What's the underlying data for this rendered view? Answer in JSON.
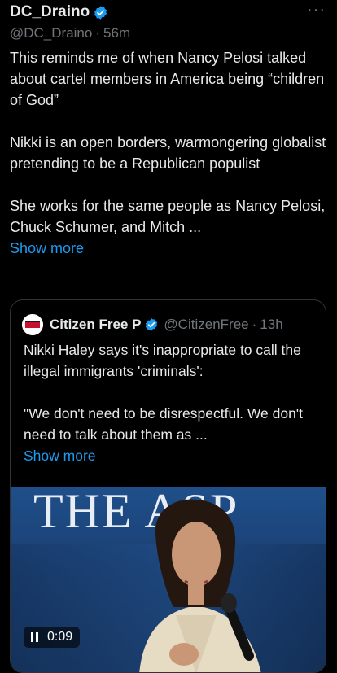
{
  "author": {
    "name": "DC_Draino",
    "handle": "@DC_Draino",
    "separator": "·",
    "time": "56m"
  },
  "more_label": "···",
  "post": {
    "paragraph1": "This reminds me of when Nancy Pelosi talked about cartel members in America being “children of God”",
    "paragraph2": "Nikki is an open borders, warmongering globalist pretending to be a Republican populist",
    "paragraph3": "She works for the same people as Nancy Pelosi, Chuck Schumer, and Mitch ...",
    "show_more": "Show more"
  },
  "quote": {
    "name": "Citizen Free P",
    "handle": "@CitizenFree",
    "separator": "·",
    "time": "13h",
    "paragraph1": "Nikki Haley says it's inappropriate to call the illegal immigrants 'criminals':",
    "paragraph2": "\"We don't need to be disrespectful. We don't need to talk about them as ...",
    "show_more": "Show more",
    "video": {
      "background_text": "THE ASP",
      "time": "0:09",
      "state": "playing"
    }
  },
  "colors": {
    "background": "#000000",
    "text": "#e7e9ea",
    "muted": "#71767b",
    "link": "#1d9bf0",
    "verified": "#1d9bf0"
  }
}
